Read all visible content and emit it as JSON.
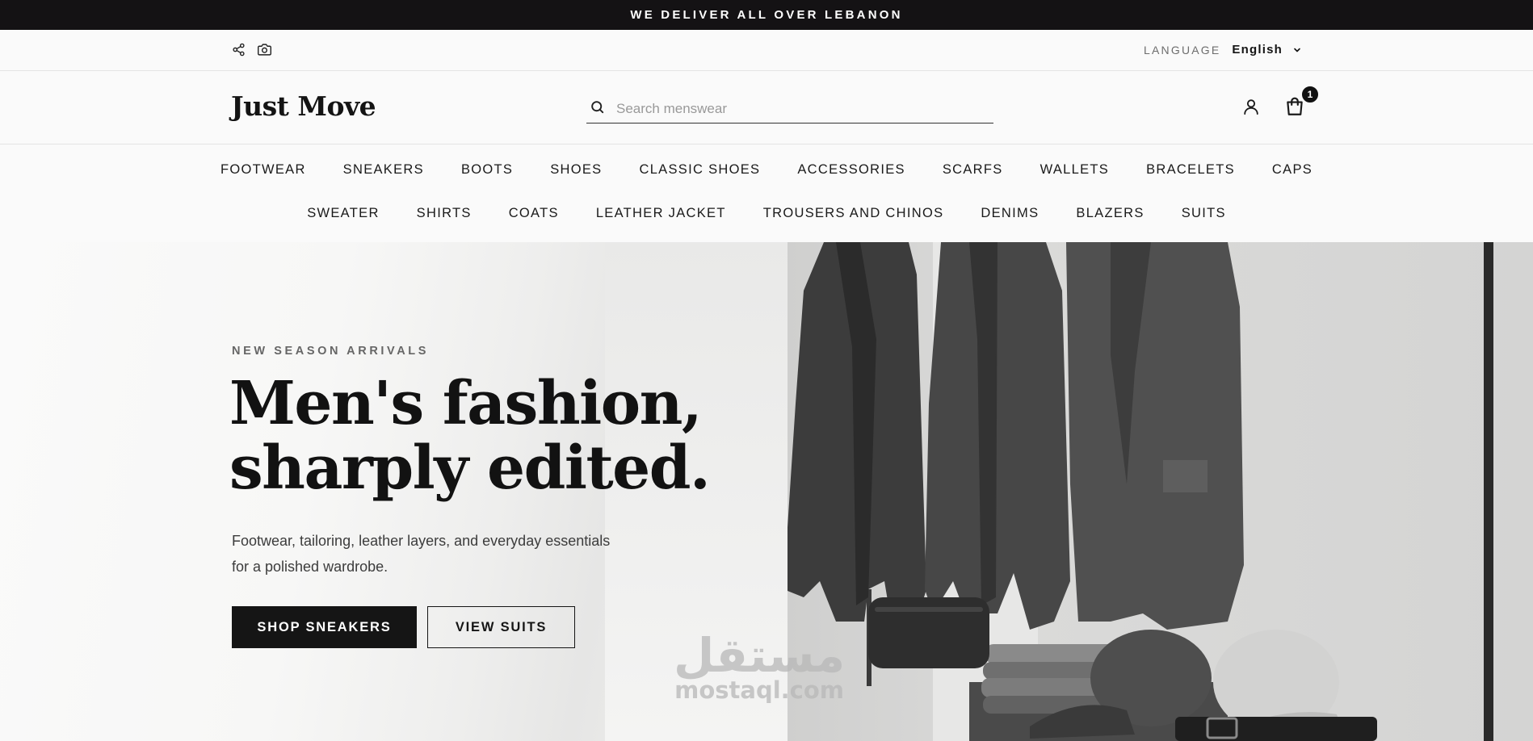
{
  "announcement": {
    "text": "WE DELIVER ALL OVER LEBANON"
  },
  "utility": {
    "icons": [
      "share-icon",
      "camera-icon"
    ],
    "language_label": "LANGUAGE",
    "language_value": "English"
  },
  "header": {
    "logo": "Just Move",
    "search_placeholder": "Search menswear",
    "cart_count": "1"
  },
  "nav": {
    "row1": [
      "FOOTWEAR",
      "SNEAKERS",
      "BOOTS",
      "SHOES",
      "CLASSIC SHOES",
      "ACCESSORIES",
      "SCARFS",
      "WALLETS",
      "BRACELETS",
      "CAPS"
    ],
    "row2": [
      "SWEATER",
      "SHIRTS",
      "COATS",
      "LEATHER JACKET",
      "TROUSERS AND CHINOS",
      "DENIMS",
      "BLAZERS",
      "SUITS"
    ]
  },
  "hero": {
    "eyebrow": "NEW SEASON ARRIVALS",
    "headline_line1": "Men's fashion,",
    "headline_line2": "sharply edited.",
    "subtext_line1": "Footwear, tailoring, leather layers, and everyday essentials",
    "subtext_line2": "for a polished wardrobe.",
    "primary_cta": "SHOP SNEAKERS",
    "secondary_cta": "VIEW SUITS"
  },
  "watermark": {
    "arabic": "مستقل",
    "latin": "mostaql.com"
  },
  "colors": {
    "dark": "#141214",
    "text": "#141414",
    "muted": "#6d6d6d",
    "background": "#fafafa"
  }
}
